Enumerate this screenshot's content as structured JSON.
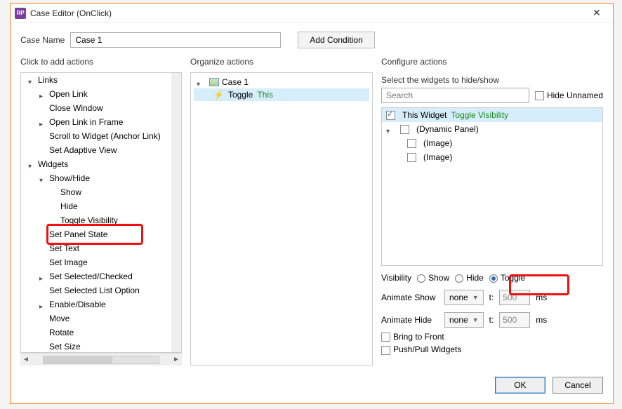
{
  "titlebar": {
    "app_badge": "RP",
    "title": "Case Editor (OnClick)"
  },
  "top": {
    "case_name_label": "Case Name",
    "case_name_value": "Case 1",
    "add_condition_label": "Add Condition"
  },
  "headers": {
    "actions": "Click to add actions",
    "organize": "Organize actions",
    "configure": "Configure actions"
  },
  "actions_tree": {
    "links": "Links",
    "open_link": "Open Link",
    "close_window": "Close Window",
    "open_link_frame": "Open Link in Frame",
    "scroll_to_widget": "Scroll to Widget (Anchor Link)",
    "set_adaptive": "Set Adaptive View",
    "widgets": "Widgets",
    "show_hide": "Show/Hide",
    "show": "Show",
    "hide": "Hide",
    "toggle_vis": "Toggle Visibility",
    "set_panel_state": "Set Panel State",
    "set_text": "Set Text",
    "set_image": "Set Image",
    "set_sel_checked": "Set Selected/Checked",
    "set_sel_list": "Set Selected List Option",
    "enable_disable": "Enable/Disable",
    "move": "Move",
    "rotate": "Rotate",
    "set_size": "Set Size"
  },
  "organize": {
    "case_label": "Case 1",
    "toggle_word": "Toggle",
    "this_word": "This"
  },
  "configure": {
    "select_title": "Select the widgets to hide/show",
    "search_placeholder": "Search",
    "hide_unnamed": "Hide Unnamed",
    "this_widget": "This Widget",
    "toggle_vis": "Toggle Visibility",
    "dynamic_panel": "(Dynamic Panel)",
    "image": "(Image)",
    "visibility_label": "Visibility",
    "opt_show": "Show",
    "opt_hide": "Hide",
    "opt_toggle": "Toggle",
    "animate_show": "Animate Show",
    "animate_hide": "Animate Hide",
    "anim_value": "none",
    "t_label": "t:",
    "t_value": "500",
    "ms": "ms",
    "bring_front": "Bring to Front",
    "push_pull": "Push/Pull Widgets"
  },
  "footer": {
    "ok": "OK",
    "cancel": "Cancel"
  }
}
